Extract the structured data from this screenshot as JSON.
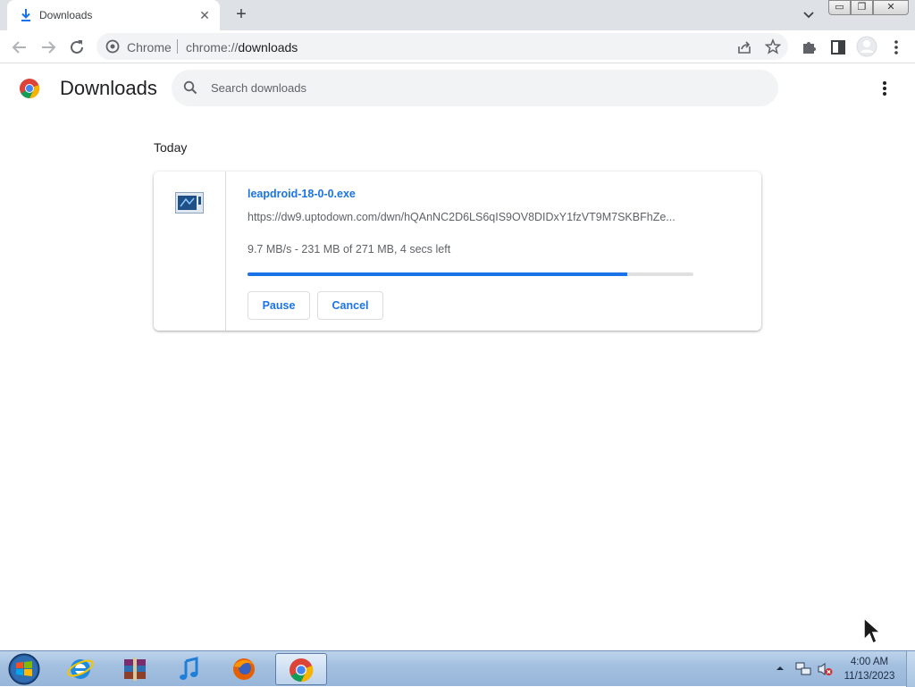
{
  "tab": {
    "title": "Downloads"
  },
  "omnibox": {
    "site_label": "Chrome",
    "url_scheme": "chrome://",
    "url_host": "downloads"
  },
  "page": {
    "title": "Downloads",
    "search_placeholder": "Search downloads"
  },
  "downloads": {
    "section_date": "Today",
    "items": [
      {
        "file_name": "leapdroid-18-0-0.exe",
        "url": "https://dw9.uptodown.com/dwn/hQAnNC2D6LS6qIS9OV8DIDxY1fzVT9M7SKBFhZe...",
        "status": "9.7 MB/s - 231 MB of 271 MB, 4 secs left",
        "progress_fraction": 0.852,
        "pause_label": "Pause",
        "cancel_label": "Cancel"
      }
    ]
  },
  "taskbar": {
    "time": "4:00 AM",
    "date": "11/13/2023",
    "apps": [
      "internet-explorer",
      "winrar",
      "itunes",
      "firefox",
      "chrome"
    ]
  },
  "colors": {
    "accent": "#1a73e8",
    "tabstrip": "#dee1e6",
    "taskbar": "#a4c0e0"
  }
}
